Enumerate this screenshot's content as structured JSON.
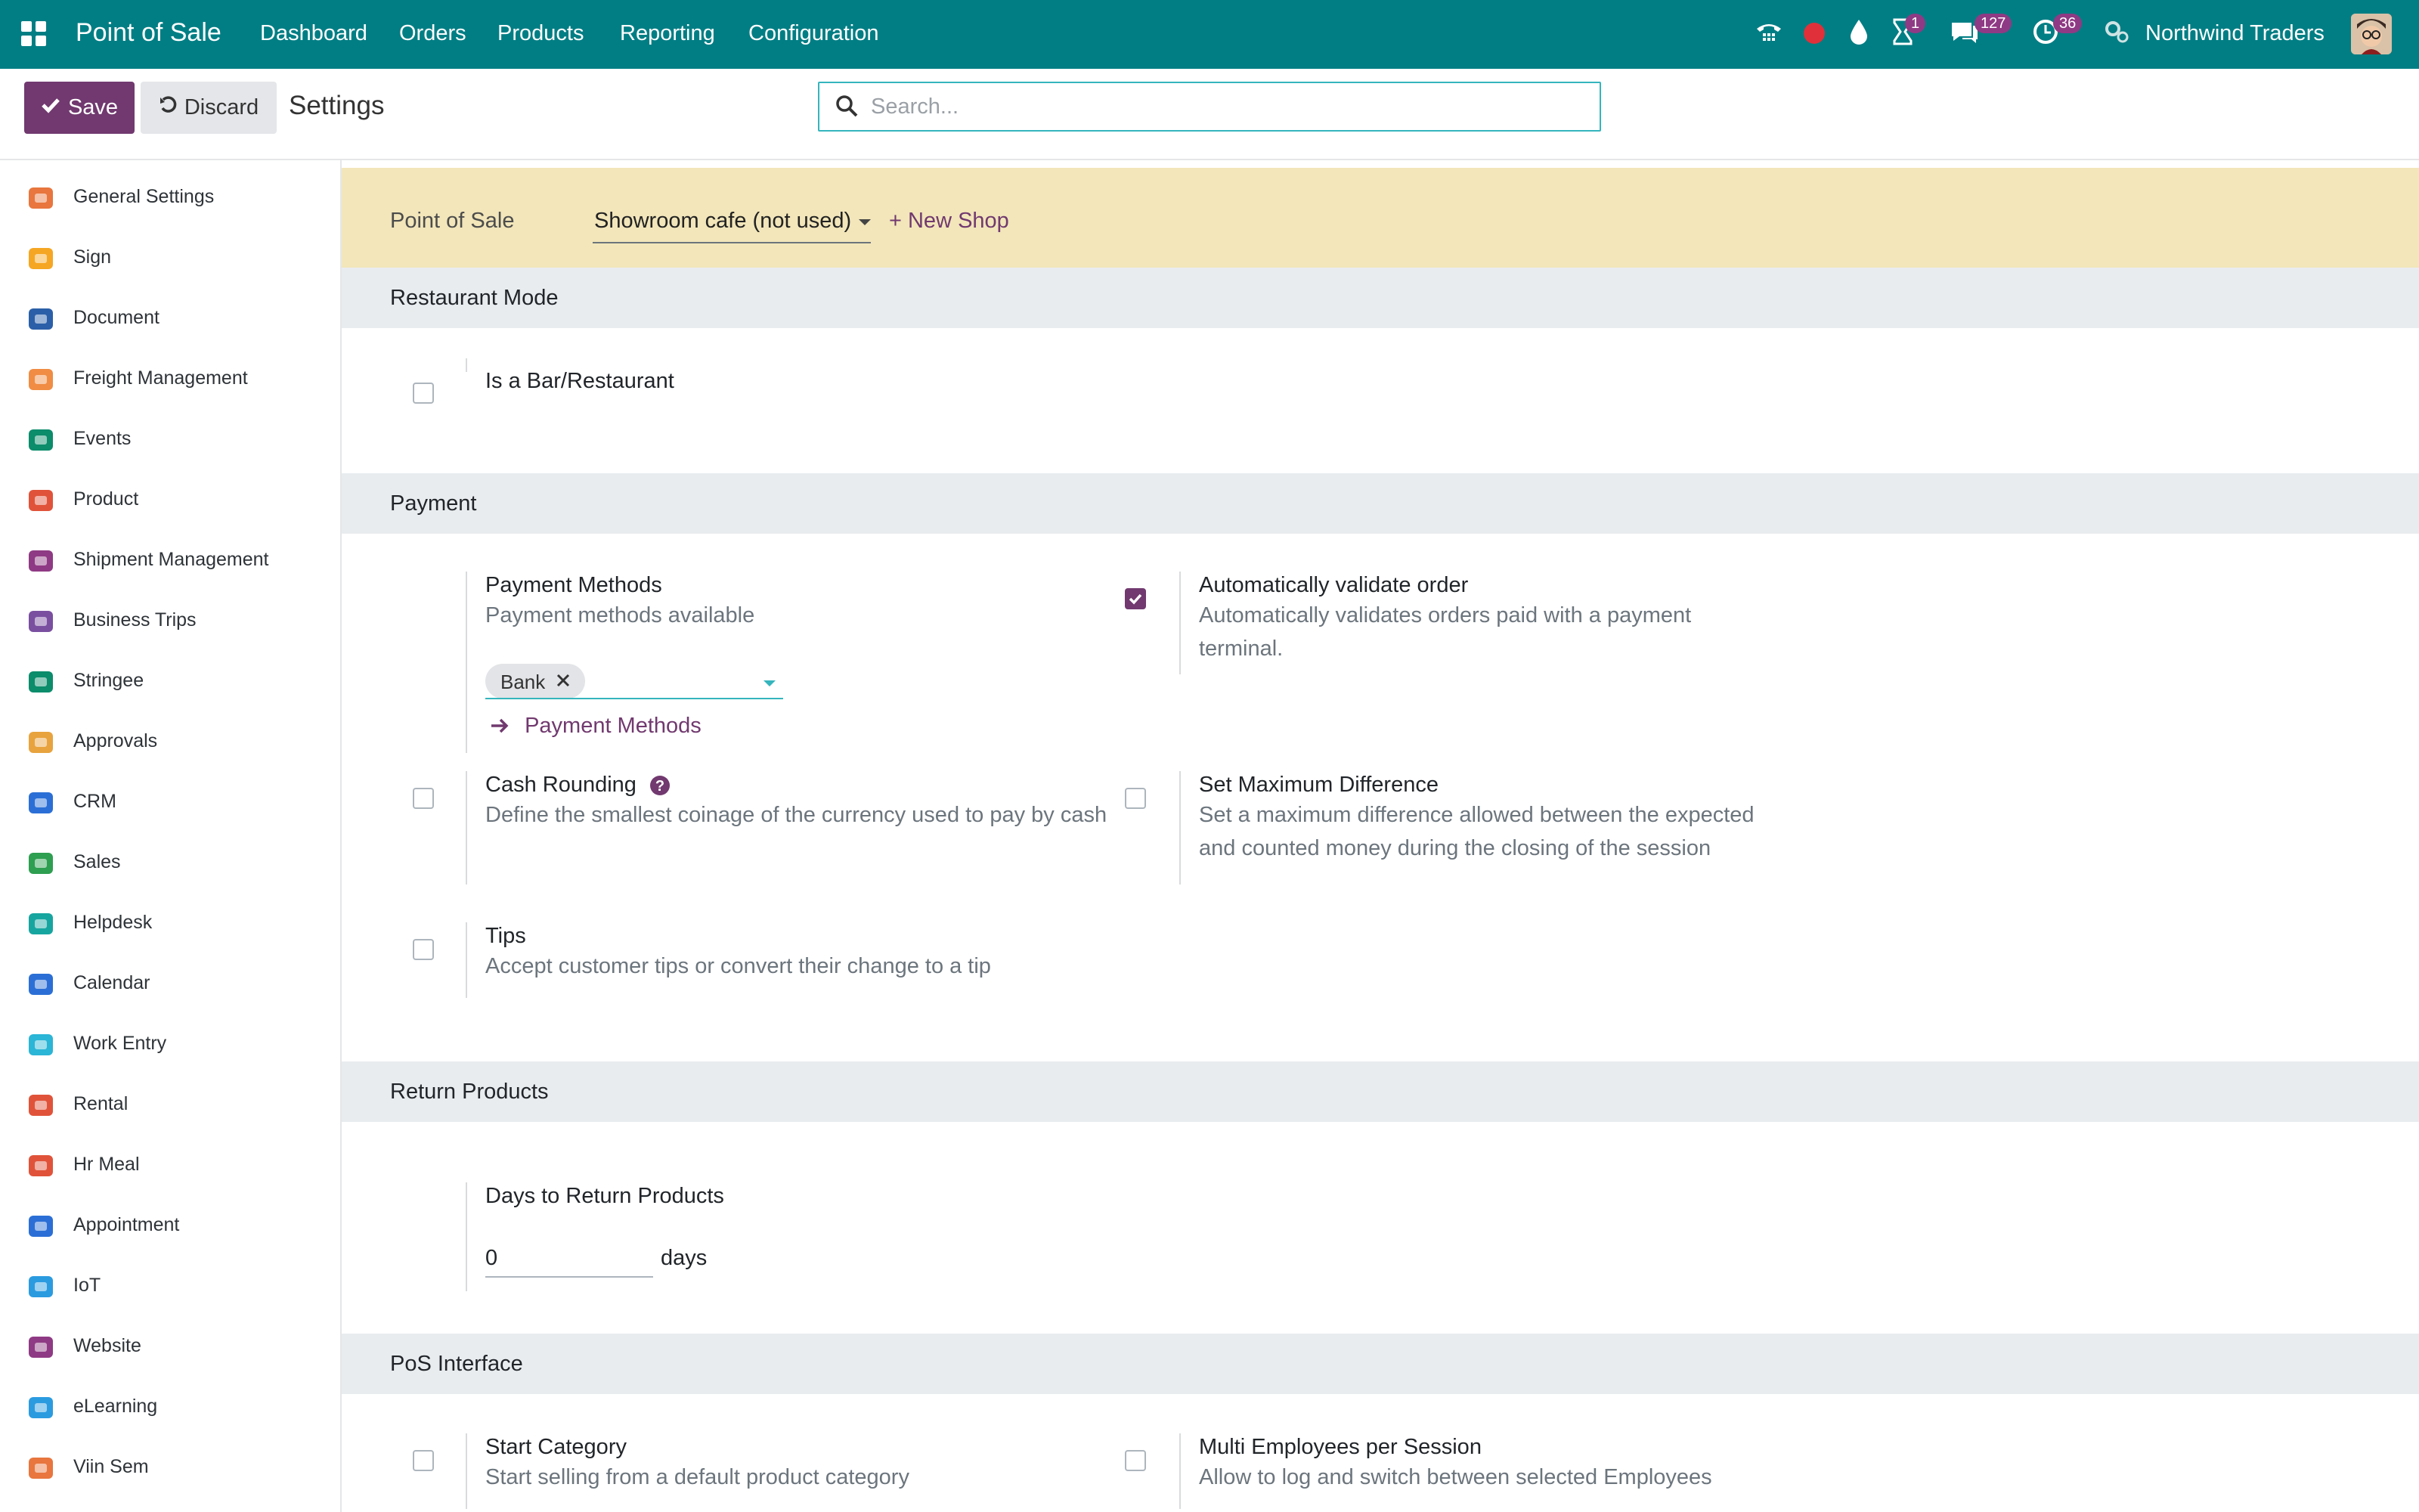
{
  "topbar": {
    "app_title": "Point of Sale",
    "menu": [
      "Dashboard",
      "Orders",
      "Products",
      "Reporting",
      "Configuration"
    ],
    "icons": [
      "phone-icon",
      "record-dot-icon",
      "drop-icon",
      "hourglass-icon",
      "chat-icon",
      "clock-icon",
      "gears-icon"
    ],
    "badges": {
      "activity": "1",
      "messages": "127",
      "clock": "36"
    },
    "company": "Northwind Traders",
    "color": "#017e84"
  },
  "control": {
    "save_label": "Save",
    "discard_label": "Discard",
    "breadcrumb": "Settings",
    "search_placeholder": "Search..."
  },
  "sidebar": {
    "items": [
      {
        "label": "General Settings",
        "icon": "general-settings-icon"
      },
      {
        "label": "Sign",
        "icon": "sign-icon"
      },
      {
        "label": "Document",
        "icon": "document-icon"
      },
      {
        "label": "Freight Management",
        "icon": "freight-icon"
      },
      {
        "label": "Events",
        "icon": "events-icon"
      },
      {
        "label": "Product",
        "icon": "product-icon"
      },
      {
        "label": "Shipment Management",
        "icon": "shipment-icon"
      },
      {
        "label": "Business Trips",
        "icon": "business-trips-icon"
      },
      {
        "label": "Stringee",
        "icon": "stringee-icon"
      },
      {
        "label": "Approvals",
        "icon": "approvals-icon"
      },
      {
        "label": "CRM",
        "icon": "crm-icon"
      },
      {
        "label": "Sales",
        "icon": "sales-icon"
      },
      {
        "label": "Helpdesk",
        "icon": "helpdesk-icon"
      },
      {
        "label": "Calendar",
        "icon": "calendar-icon"
      },
      {
        "label": "Work Entry",
        "icon": "work-entry-icon"
      },
      {
        "label": "Rental",
        "icon": "rental-icon"
      },
      {
        "label": "Hr Meal",
        "icon": "hr-meal-icon"
      },
      {
        "label": "Appointment",
        "icon": "appointment-icon"
      },
      {
        "label": "IoT",
        "icon": "iot-icon"
      },
      {
        "label": "Website",
        "icon": "website-icon"
      },
      {
        "label": "eLearning",
        "icon": "elearning-icon"
      },
      {
        "label": "Viin Sem",
        "icon": "viin-sem-icon"
      }
    ]
  },
  "shop": {
    "label": "Point of Sale",
    "selected": "Showroom cafe (not used)",
    "new_shop": "+ New Shop"
  },
  "sections": {
    "restaurant": {
      "title": "Restaurant Mode",
      "bar_restaurant": {
        "title": "Is a Bar/Restaurant",
        "checked": false
      }
    },
    "payment": {
      "title": "Payment",
      "payment_methods": {
        "title": "Payment Methods",
        "desc": "Payment methods available",
        "tags": [
          "Bank"
        ],
        "link": "Payment Methods"
      },
      "auto_validate": {
        "title": "Automatically validate order",
        "desc": "Automatically validates orders paid with a payment terminal.",
        "checked": true
      },
      "cash_rounding": {
        "title": "Cash Rounding",
        "desc": "Define the smallest coinage of the currency used to pay by cash",
        "checked": false
      },
      "max_difference": {
        "title": "Set Maximum Difference",
        "desc": "Set a maximum difference allowed between the expected and counted money during the closing of the session",
        "checked": false
      },
      "tips": {
        "title": "Tips",
        "desc": "Accept customer tips or convert their change to a tip",
        "checked": false
      }
    },
    "returns": {
      "title": "Return Products",
      "days": {
        "title": "Days to Return Products",
        "value": "0",
        "unit": "days"
      }
    },
    "interface": {
      "title": "PoS Interface",
      "start_category": {
        "title": "Start Category",
        "desc": "Start selling from a default product category",
        "checked": false
      },
      "multi_employees": {
        "title": "Multi Employees per Session",
        "desc": "Allow to log and switch between selected Employees",
        "checked": false
      }
    }
  },
  "colors": {
    "accent": "#71396f",
    "teal": "#017e84",
    "banner": "#f2e6ba",
    "section": "#e9ecef"
  }
}
